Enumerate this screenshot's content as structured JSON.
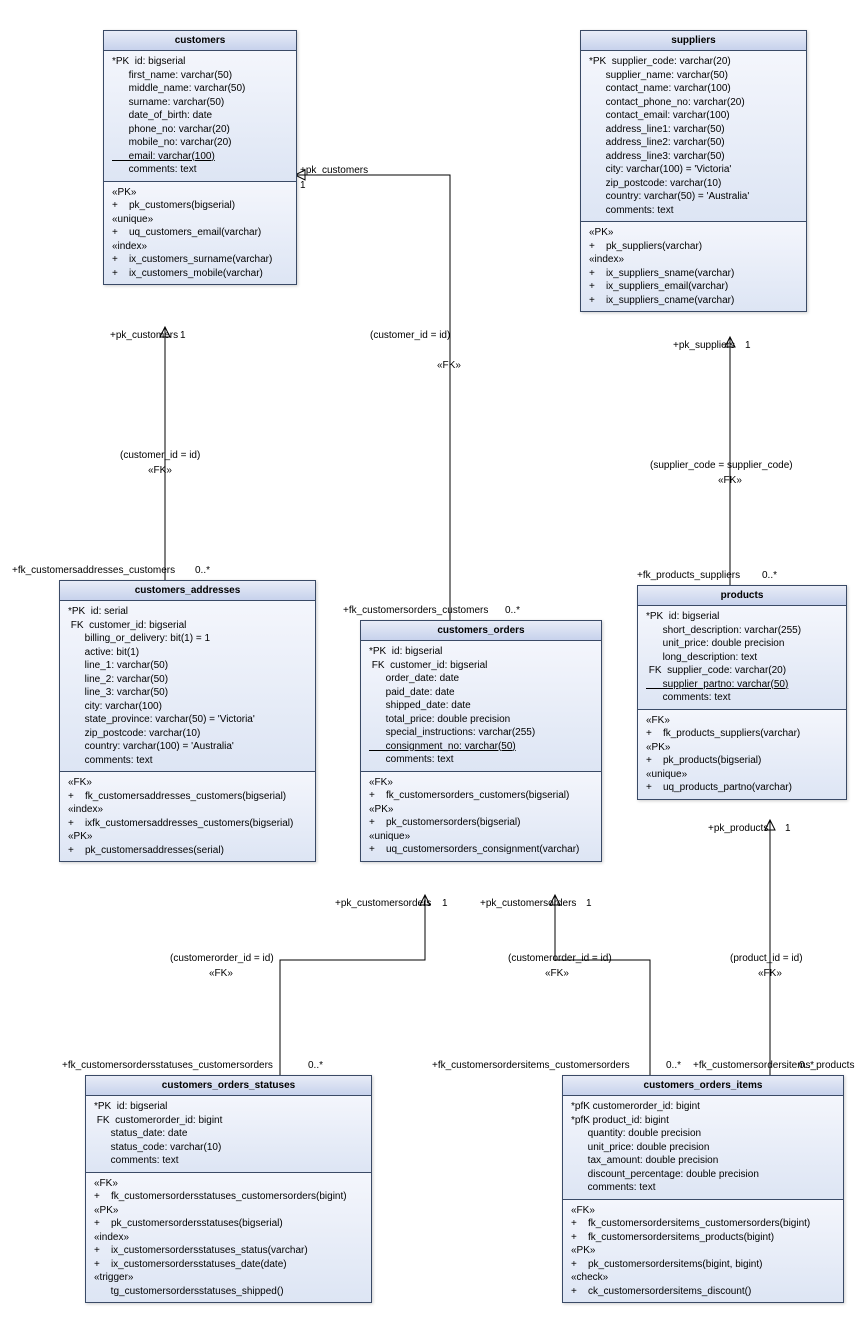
{
  "customers": {
    "title": "customers",
    "cols": [
      "*PK  id: bigserial",
      "      first_name: varchar(50)",
      "      middle_name: varchar(50)",
      "      surname: varchar(50)",
      "      date_of_birth: date",
      "      phone_no: varchar(20)",
      "      mobile_no: varchar(20)",
      "      email: varchar(100)",
      "      comments: text"
    ],
    "constraints": [
      "«PK»",
      "+    pk_customers(bigserial)",
      "«unique»",
      "+    uq_customers_email(varchar)",
      "«index»",
      "+    ix_customers_surname(varchar)",
      "+    ix_customers_mobile(varchar)"
    ]
  },
  "suppliers": {
    "title": "suppliers",
    "cols": [
      "*PK  supplier_code: varchar(20)",
      "      supplier_name: varchar(50)",
      "      contact_name: varchar(100)",
      "      contact_phone_no: varchar(20)",
      "      contact_email: varchar(100)",
      "      address_line1: varchar(50)",
      "      address_line2: varchar(50)",
      "      address_line3: varchar(50)",
      "      city: varchar(100) = 'Victoria'",
      "      zip_postcode: varchar(10)",
      "      country: varchar(50) = 'Australia'",
      "      comments: text"
    ],
    "constraints": [
      "«PK»",
      "+    pk_suppliers(varchar)",
      "«index»",
      "+    ix_suppliers_sname(varchar)",
      "+    ix_suppliers_email(varchar)",
      "+    ix_suppliers_cname(varchar)"
    ]
  },
  "customers_addresses": {
    "title": "customers_addresses",
    "cols": [
      "*PK  id: serial",
      " FK  customer_id: bigserial",
      "      billing_or_delivery: bit(1) = 1",
      "      active: bit(1)",
      "      line_1: varchar(50)",
      "      line_2: varchar(50)",
      "      line_3: varchar(50)",
      "      city: varchar(100)",
      "      state_province: varchar(50) = 'Victoria'",
      "      zip_postcode: varchar(10)",
      "      country: varchar(100) = 'Australia'",
      "      comments: text"
    ],
    "constraints": [
      "«FK»",
      "+    fk_customersaddresses_customers(bigserial)",
      "«index»",
      "+    ixfk_customersaddresses_customers(bigserial)",
      "«PK»",
      "+    pk_customersaddresses(serial)"
    ]
  },
  "customers_orders": {
    "title": "customers_orders",
    "cols": [
      "*PK  id: bigserial",
      " FK  customer_id: bigserial",
      "      order_date: date",
      "      paid_date: date",
      "      shipped_date: date",
      "      total_price: double precision",
      "      special_instructions: varchar(255)",
      "      consignment_no: varchar(50)",
      "      comments: text"
    ],
    "constraints": [
      "«FK»",
      "+    fk_customersorders_customers(bigserial)",
      "«PK»",
      "+    pk_customersorders(bigserial)",
      "«unique»",
      "+    uq_customersorders_consignment(varchar)"
    ]
  },
  "products": {
    "title": "products",
    "cols": [
      "*PK  id: bigserial",
      "      short_description: varchar(255)",
      "      unit_price: double precision",
      "      long_description: text",
      " FK  supplier_code: varchar(20)",
      "      supplier_partno: varchar(50)",
      "      comments: text"
    ],
    "constraints": [
      "«FK»",
      "+    fk_products_suppliers(varchar)",
      "«PK»",
      "+    pk_products(bigserial)",
      "«unique»",
      "+    uq_products_partno(varchar)"
    ]
  },
  "customers_orders_statuses": {
    "title": "customers_orders_statuses",
    "cols": [
      "*PK  id: bigserial",
      " FK  customerorder_id: bigint",
      "      status_date: date",
      "      status_code: varchar(10)",
      "      comments: text"
    ],
    "constraints": [
      "«FK»",
      "+    fk_customersordersstatuses_customersorders(bigint)",
      "«PK»",
      "+    pk_customersordersstatuses(bigserial)",
      "«index»",
      "+    ix_customersordersstatuses_status(varchar)",
      "+    ix_customersordersstatuses_date(date)",
      "«trigger»",
      "      tg_customersordersstatuses_shipped()"
    ]
  },
  "customers_orders_items": {
    "title": "customers_orders_items",
    "cols": [
      "*pfK customerorder_id: bigint",
      "*pfK product_id: bigint",
      "      quantity: double precision",
      "      unit_price: double precision",
      "      tax_amount: double precision",
      "      discount_percentage: double precision",
      "      comments: text"
    ],
    "constraints": [
      "«FK»",
      "+    fk_customersordersitems_customersorders(bigint)",
      "+    fk_customersordersitems_products(bigint)",
      "«PK»",
      "+    pk_customersordersitems(bigint, bigint)",
      "«check»",
      "+    ck_customersordersitems_discount()"
    ]
  },
  "labels": {
    "l1": "+pk_customers",
    "l1a": "1",
    "l2": "(customer_id = id)",
    "l3": "«FK»",
    "l4": "+pk_customers",
    "l4a": "1",
    "l5": "(customer_id = id)",
    "l6": "«FK»",
    "l7": "+fk_customersaddresses_customers",
    "l7a": "0..*",
    "l8": "+fk_customersorders_customers",
    "l8a": "0..*",
    "l9": "+pk_suppliers",
    "l9a": "1",
    "l10": "(supplier_code = supplier_code)",
    "l11": "«FK»",
    "l12": "+fk_products_suppliers",
    "l12a": "0..*",
    "l13": "+pk_customersorders",
    "l13a": "1",
    "l14": "(customerorder_id = id)",
    "l15": "«FK»",
    "l16": "+fk_customersordersstatuses_customersorders",
    "l16a": "0..*",
    "l17": "+pk_customersorders",
    "l17a": "1",
    "l18": "(customerorder_id = id)",
    "l19": "«FK»",
    "l20": "+fk_customersordersitems_customersorders",
    "l20a": "0..*",
    "l21": "+pk_products",
    "l21a": "1",
    "l22": "(product_id = id)",
    "l23": "«FK»",
    "l24": "+fk_customersordersitems_products",
    "l24a": "0..*"
  }
}
